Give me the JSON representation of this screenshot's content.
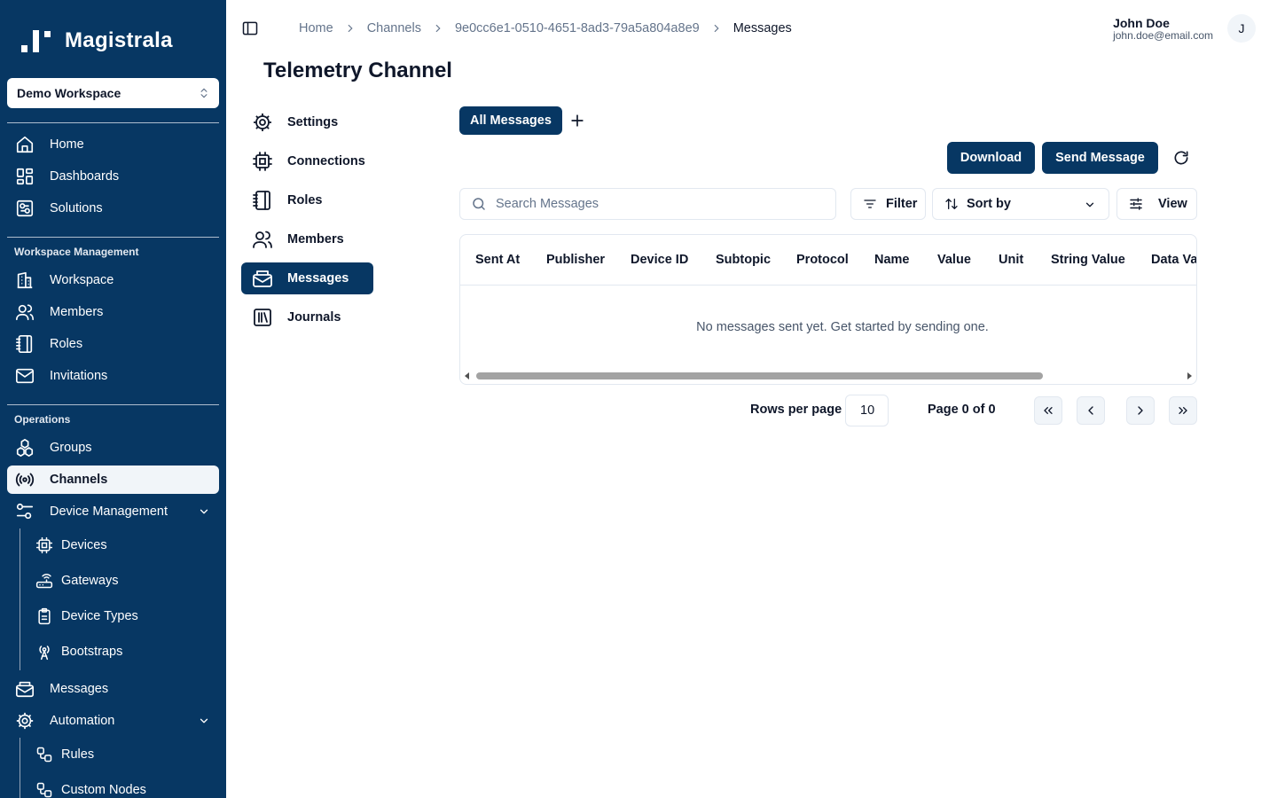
{
  "app": {
    "name": "Magistrala"
  },
  "sidebar": {
    "workspace_selector": "Demo Workspace",
    "main_items": [
      {
        "label": "Home",
        "icon": "home-icon"
      },
      {
        "label": "Dashboards",
        "icon": "dashboards-icon"
      },
      {
        "label": "Solutions",
        "icon": "solutions-icon"
      }
    ],
    "workspace_section": "Workspace Management",
    "workspace_items": [
      {
        "label": "Workspace",
        "icon": "building-icon"
      },
      {
        "label": "Members",
        "icon": "users-icon"
      },
      {
        "label": "Roles",
        "icon": "notebook-icon"
      },
      {
        "label": "Invitations",
        "icon": "mail-icon"
      }
    ],
    "operations_section": "Operations",
    "operations_items": [
      {
        "label": "Groups",
        "icon": "groups-icon"
      },
      {
        "label": "Channels",
        "icon": "radio-icon",
        "active": true
      },
      {
        "label": "Device Management",
        "icon": "sliders-icon",
        "expanded": true
      }
    ],
    "device_sub_items": [
      {
        "label": "Devices",
        "icon": "cpu-icon"
      },
      {
        "label": "Gateways",
        "icon": "router-icon"
      },
      {
        "label": "Device Types",
        "icon": "clipboard-icon"
      },
      {
        "label": "Bootstraps",
        "icon": "antenna-icon"
      }
    ],
    "bottom_items": [
      {
        "label": "Messages",
        "icon": "mail-open-icon"
      },
      {
        "label": "Automation",
        "icon": "gear-icon",
        "expanded": true
      }
    ],
    "automation_sub_items": [
      {
        "label": "Rules",
        "icon": "workflow-icon"
      },
      {
        "label": "Custom Nodes",
        "icon": "workflow-icon"
      }
    ]
  },
  "header": {
    "breadcrumb": [
      "Home",
      "Channels",
      "9e0cc6e1-0510-4651-8ad3-79a5a804a8e9",
      "Messages"
    ],
    "user": {
      "name": "John Doe",
      "email": "john.doe@email.com",
      "initial": "J"
    }
  },
  "page": {
    "title": "Telemetry Channel"
  },
  "channel_nav": [
    {
      "label": "Settings",
      "icon": "gear-icon"
    },
    {
      "label": "Connections",
      "icon": "cpu-icon"
    },
    {
      "label": "Roles",
      "icon": "notebook-icon"
    },
    {
      "label": "Members",
      "icon": "users-icon"
    },
    {
      "label": "Messages",
      "icon": "mail-open-icon",
      "active": true
    },
    {
      "label": "Journals",
      "icon": "library-icon"
    }
  ],
  "messages": {
    "tab_label": "All Messages",
    "download_label": "Download",
    "send_label": "Send Message",
    "search_placeholder": "Search Messages",
    "filter_label": "Filter",
    "sort_label": "Sort by",
    "view_label": "View",
    "columns": [
      "Sent At",
      "Publisher",
      "Device ID",
      "Subtopic",
      "Protocol",
      "Name",
      "Value",
      "Unit",
      "String Value",
      "Data Va"
    ],
    "empty_text": "No messages sent yet. Get started by sending one."
  },
  "pagination": {
    "rows_label": "Rows per page",
    "rows_value": "10",
    "page_text": "Page 0 of 0"
  },
  "colors": {
    "primary": "#073763",
    "active_bg": "#f1f5f9",
    "border": "#e2e8f0"
  }
}
